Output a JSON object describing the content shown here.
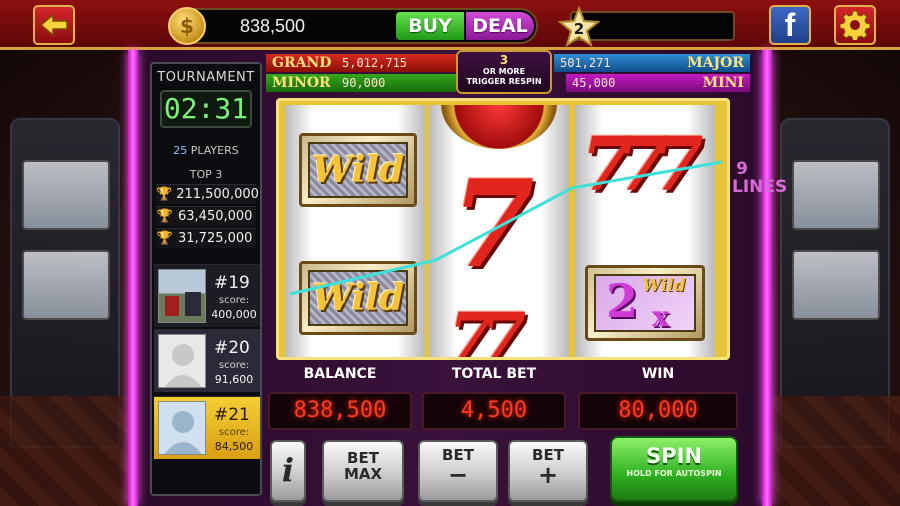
{
  "header": {
    "coins": "838,500",
    "buy_label": "BUY",
    "deal_label": "DEAL",
    "level": "2",
    "level_progress": 0.0,
    "icons": {
      "back": "back-arrow-icon",
      "coin": "coin-icon",
      "star": "star-icon",
      "facebook": "facebook-icon",
      "settings": "gear-icon"
    },
    "facebook_glyph": "f",
    "coin_glyph": "$"
  },
  "tournament": {
    "title": "TOURNAMENT",
    "timer": "02:31",
    "players_count": "25",
    "players_label": "PLAYERS",
    "top_label": "TOP 3",
    "top3": [
      {
        "score": "211,500,000",
        "trophy": "gold"
      },
      {
        "score": "63,450,000",
        "trophy": "silver"
      },
      {
        "score": "31,725,000",
        "trophy": "bronze"
      }
    ],
    "players": [
      {
        "rank": "#19",
        "score_label": "score:",
        "score": "400,000",
        "me": false
      },
      {
        "rank": "#20",
        "score_label": "score:",
        "score": "91,600",
        "me": false
      },
      {
        "rank": "#21",
        "score_label": "score:",
        "score": "84,500",
        "me": true
      }
    ]
  },
  "jackpots": {
    "grand": {
      "label": "GRAND",
      "value": "5,012,715"
    },
    "minor": {
      "label": "MINOR",
      "value": "90,000"
    },
    "major": {
      "label": "MAJOR",
      "value": "501,271"
    },
    "mini": {
      "label": "MINI",
      "value": "45,000"
    },
    "trigger": {
      "count": "3",
      "line1": "OR MORE",
      "line2": "TRIGGER RESPIN"
    }
  },
  "reels": {
    "wild_text": "Wild",
    "seven_glyph": "7",
    "wild2x": {
      "two": "2",
      "wild": "Wild",
      "x": "x"
    },
    "lines_label": "9 LINES"
  },
  "stats": {
    "balance_label": "BALANCE",
    "balance": "838,500",
    "bet_label": "TOTAL BET",
    "bet": "4,500",
    "win_label": "WIN",
    "win": "80,000"
  },
  "controls": {
    "info": "i",
    "bet_max_1": "BET",
    "bet_max_2": "MAX",
    "bet_minus_1": "BET",
    "bet_minus_2": "−",
    "bet_plus_1": "BET",
    "bet_plus_2": "+",
    "spin": "SPIN",
    "spin_sub": "HOLD FOR AUTOSPIN"
  },
  "colors": {
    "neon": "#ff50ff",
    "led": "#ff3a22",
    "timer": "#7df27a",
    "buy": "#2eb020",
    "deal": "#a020b0",
    "payline": "#3fe0d8"
  }
}
